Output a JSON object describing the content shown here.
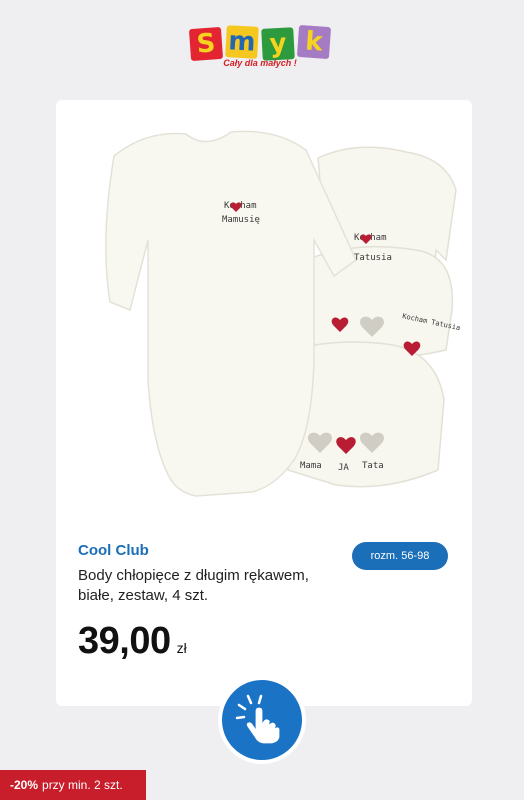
{
  "logo": {
    "letters": [
      "S",
      "m",
      "y",
      "k"
    ],
    "tagline": "Cały dla małych !"
  },
  "product": {
    "brand": "Cool Club",
    "size_label": "rozm. 56-98",
    "name": "Body chłopięce z długim rękawem, białe, zestaw, 4 szt.",
    "price": "39,00",
    "currency": "zł",
    "image_print": {
      "front": [
        "Kocham",
        "Mamusię"
      ],
      "back1": [
        "Kocham",
        "Tatusia"
      ],
      "back2": "Kocham Tatusia",
      "back3": [
        "Mama",
        "JA",
        "Tata"
      ]
    }
  },
  "promo": {
    "discount": "-20%",
    "condition": "przy min. 2 szt."
  },
  "colors": {
    "accent": "#1b6fb8",
    "promo": "#c81e2c",
    "background": "#efeff1"
  },
  "icons": {
    "tap": "hand-tap-icon"
  }
}
